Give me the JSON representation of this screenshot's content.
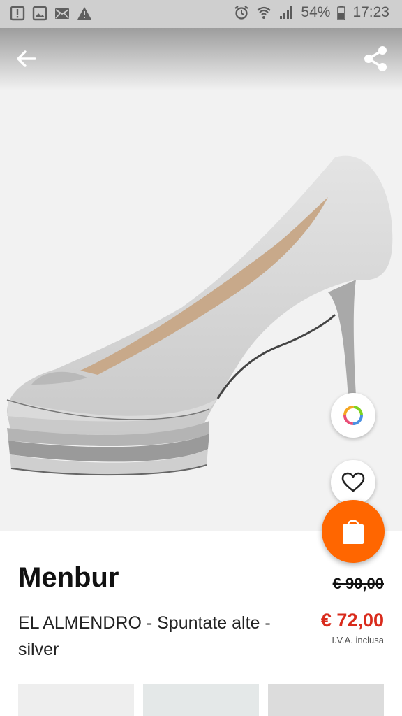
{
  "status_bar": {
    "battery": "54%",
    "time": "17:23",
    "left_icons": [
      "alert-box-icon",
      "image-icon",
      "mail-icon",
      "warning-icon"
    ],
    "right_icons": [
      "alarm-icon",
      "wifi-icon",
      "signal-icon",
      "battery-icon"
    ]
  },
  "toolbar": {
    "back_icon": "arrow-left-icon",
    "share_icon": "share-icon"
  },
  "product": {
    "brand": "Menbur",
    "name": "EL ALMENDRO - Spuntate alte - silver",
    "old_price": "€ 90,00",
    "price": "€ 72,00",
    "vat_note": "I.V.A. inclusa"
  },
  "actions": {
    "color_icon": "color-ring-icon",
    "favorite_icon": "heart-icon",
    "cart_icon": "shopping-bag-icon"
  },
  "colors": {
    "accent": "#ff6600",
    "sale_price": "#d92b1c"
  }
}
